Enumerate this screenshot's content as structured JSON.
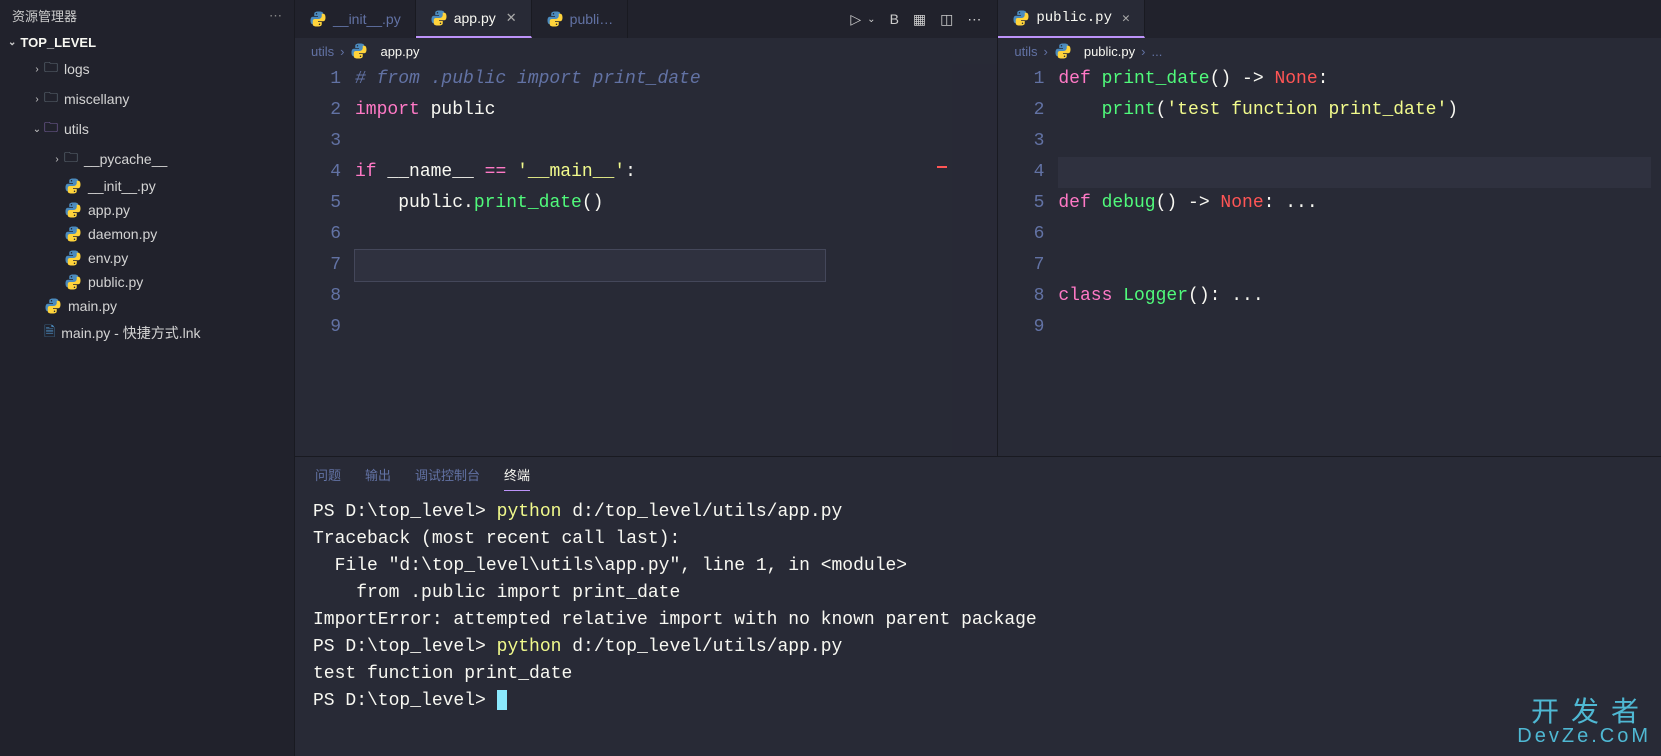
{
  "sidebar": {
    "title": "资源管理器",
    "project": "TOP_LEVEL",
    "items": [
      {
        "type": "folder",
        "name": "logs",
        "depth": 1,
        "open": false
      },
      {
        "type": "folder",
        "name": "miscellany",
        "depth": 1,
        "open": false
      },
      {
        "type": "folder",
        "name": "utils",
        "depth": 1,
        "open": true
      },
      {
        "type": "folder",
        "name": "__pycache__",
        "depth": 2,
        "open": false
      },
      {
        "type": "py",
        "name": "__init__.py",
        "depth": 2
      },
      {
        "type": "py",
        "name": "app.py",
        "depth": 2
      },
      {
        "type": "py",
        "name": "daemon.py",
        "depth": 2
      },
      {
        "type": "py",
        "name": "env.py",
        "depth": 2
      },
      {
        "type": "py",
        "name": "public.py",
        "depth": 2
      },
      {
        "type": "py",
        "name": "main.py",
        "depth": 1
      },
      {
        "type": "file",
        "name": "main.py - 快捷方式.lnk",
        "depth": 1
      }
    ]
  },
  "tabs_left": [
    {
      "name": "__init__.py",
      "active": false,
      "close": false
    },
    {
      "name": "app.py",
      "active": true,
      "close": true
    },
    {
      "name": "publi…",
      "active": false,
      "close": false
    }
  ],
  "tabs_right": [
    {
      "name": "public.py",
      "active": true,
      "close": true
    }
  ],
  "breadcrumb_left": [
    "utils",
    "app.py"
  ],
  "breadcrumb_right": [
    "utils",
    "public.py",
    "..."
  ],
  "editor_left": {
    "lines": [
      {
        "n": 1,
        "html": "<span class='tok-comment'># from .public import print_date</span>"
      },
      {
        "n": 2,
        "html": "<span class='tok-kw'>import</span> public"
      },
      {
        "n": 3,
        "html": ""
      },
      {
        "n": 4,
        "html": "<span class='tok-kw'>if</span> __name__ <span class='tok-op'>==</span> <span class='tok-str'>'__main__'</span>:"
      },
      {
        "n": 5,
        "html": "    public.<span class='tok-func'>print_date</span>()"
      },
      {
        "n": 6,
        "html": ""
      },
      {
        "n": 7,
        "html": "<span class='line-cursor-box'> </span>"
      },
      {
        "n": 8,
        "html": ""
      },
      {
        "n": 9,
        "html": ""
      }
    ]
  },
  "editor_right": {
    "lines": [
      {
        "n": 1,
        "html": "<span class='tok-kw'>def</span> <span class='tok-func'>print_date</span>() -> <span class='tok-none'>None</span>:"
      },
      {
        "n": 2,
        "html": "    <span class='tok-func'>print</span>(<span class='tok-str'>'test function print_date'</span>)"
      },
      {
        "n": 3,
        "html": ""
      },
      {
        "n": 4,
        "html": "<span class='line-highlight'> </span>"
      },
      {
        "n": 5,
        "html": "<span class='tok-kw'>def</span> <span class='tok-func'>debug</span>() -> <span class='tok-none'>None</span>: ..."
      },
      {
        "n": 6,
        "html": ""
      },
      {
        "n": 7,
        "html": ""
      },
      {
        "n": 8,
        "html": "<span class='tok-kw'>class</span> <span class='tok-cls'>Logger</span>(): ..."
      },
      {
        "n": 9,
        "html": ""
      }
    ]
  },
  "panel_tabs": [
    "问题",
    "输出",
    "调试控制台",
    "终端"
  ],
  "panel_active": "终端",
  "terminal_lines": [
    {
      "text": "PS D:\\top_level> ",
      "cmd": "python",
      "rest": " d:/top_level/utils/app.py"
    },
    {
      "text": "Traceback (most recent call last):"
    },
    {
      "text": "  File \"d:\\top_level\\utils\\app.py\", line 1, in <module>"
    },
    {
      "text": "    from .public import print_date"
    },
    {
      "text": "ImportError: attempted relative import with no known parent package"
    },
    {
      "text": "PS D:\\top_level> ",
      "cmd": "python",
      "rest": " d:/top_level/utils/app.py"
    },
    {
      "text": "test function print_date"
    },
    {
      "text": "PS D:\\top_level> ",
      "cursor": true
    }
  ],
  "watermark": {
    "cn": "开发者",
    "en": "DevZe.CoM"
  }
}
